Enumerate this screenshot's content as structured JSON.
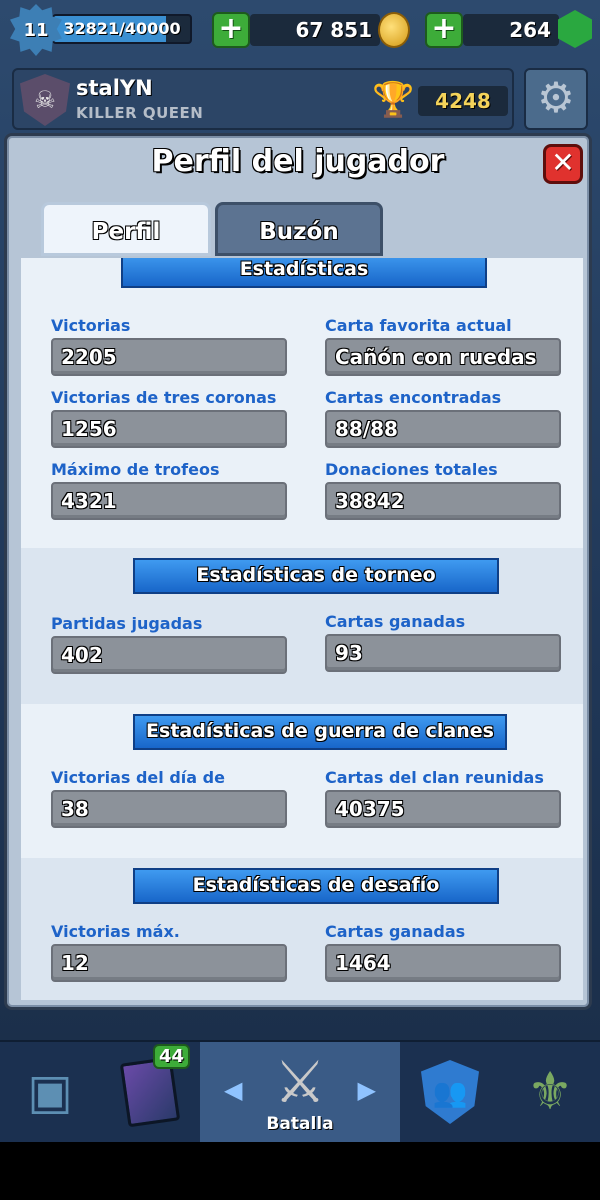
{
  "header": {
    "level": "11",
    "xp_text": "32821/40000",
    "xp_fraction": 0.8205,
    "gold": "67 851",
    "gems": "264",
    "plus_label": "+"
  },
  "profile": {
    "player_name": "stalYN",
    "clan_name": "KILLER QUEEN",
    "trophies": "4248"
  },
  "modal": {
    "title": "Perfil del jugador",
    "close_label": "✕",
    "tabs": [
      "Perfil",
      "Buzón"
    ],
    "sections": [
      {
        "title": "Estadísticas",
        "rows": [
          [
            {
              "label": "Victorias",
              "value": "2205"
            },
            {
              "label": "Carta favorita actual",
              "value": "Cañón con ruedas"
            }
          ],
          [
            {
              "label": "Victorias de tres coronas",
              "value": "1256"
            },
            {
              "label": "Cartas encontradas",
              "value": "88/88"
            }
          ],
          [
            {
              "label": "Máximo de trofeos",
              "value": "4321"
            },
            {
              "label": "Donaciones totales",
              "value": "38842"
            }
          ]
        ]
      },
      {
        "title": "Estadísticas de torneo",
        "rows": [
          [
            {
              "label": "Partidas jugadas",
              "value": "402"
            },
            {
              "label": "Cartas ganadas",
              "value": "93"
            }
          ]
        ]
      },
      {
        "title": "Estadísticas de guerra de clanes",
        "rows": [
          [
            {
              "label": "Victorias del día de guerra",
              "value": "38"
            },
            {
              "label": "Cartas del clan reunidas",
              "value": "40375"
            }
          ]
        ]
      },
      {
        "title": "Estadísticas de desafío",
        "rows": [
          [
            {
              "label": "Victorias máx.",
              "value": "12"
            },
            {
              "label": "Cartas ganadas",
              "value": "1464"
            }
          ]
        ]
      }
    ]
  },
  "nav": {
    "cards_badge": "44",
    "battle_label": "Batalla",
    "icons": [
      "chest-icon",
      "cards-icon",
      "battle-swords-icon",
      "clan-icon",
      "tournament-icon"
    ]
  },
  "colors": {
    "label_blue": "#1e63c8",
    "ribbon_blue": "#2a7fe0",
    "close_red": "#e0322e",
    "plus_green": "#3dac39"
  }
}
